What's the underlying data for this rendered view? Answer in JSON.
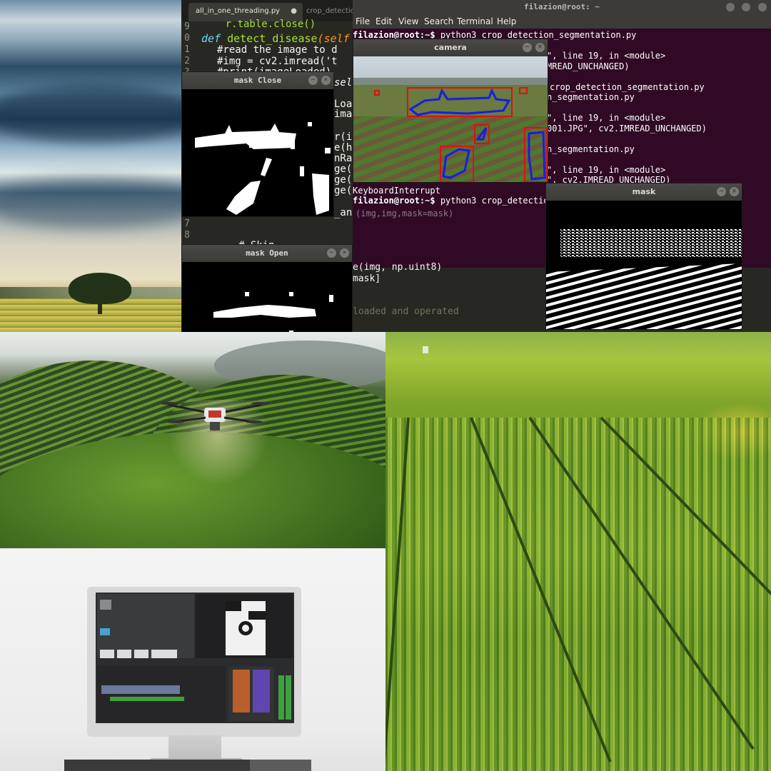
{
  "editor": {
    "tab_active": "all_in_one_threading.py",
    "tab_active_dot": "●",
    "tab_inactive": "crop_detectio",
    "lines": [
      {
        "n": "9",
        "text": "    r.table.close()"
      },
      {
        "n": "0",
        "kw": "def",
        "fn": "detect_disease",
        "rest": "(self"
      },
      {
        "n": "1",
        "cm": "#read the image to d"
      },
      {
        "n": "2",
        "text": "#img = cv2.imread('t"
      },
      {
        "n": "3",
        "cm": "#print(imageLoaded)"
      }
    ],
    "self_fragment": "sel",
    "partial_lines": [
      "Loa",
      "ima",
      "r(i",
      "e(h",
      "nRa",
      "ge(",
      "ge(",
      "ge("
    ],
    "lower_lines": [
      {
        "n": "7",
        "text": ""
      },
      {
        "n": "8",
        "text": ""
      }
    ],
    "lower_fragment": "_an",
    "comment_fragment": "# Skin"
  },
  "windows": {
    "mask_close_title": "mask Close",
    "mask_open_title": "mask Open",
    "camera_title": "camera",
    "mask_title": "mask",
    "btn_min": "−",
    "btn_close": "×"
  },
  "terminal": {
    "title": "filazion@root: ~",
    "menu": [
      "File",
      "Edit",
      "View",
      "Search",
      "Terminal",
      "Help"
    ],
    "lines": [
      {
        "prompt": "filazion@root:~$ ",
        "text": "python3 crop_detection_segmentation.py"
      },
      {
        "text": "\", line 19, in <module>"
      },
      {
        "text": "MREAD_UNCHANGED)"
      },
      {
        "text": "crop_detection_segmentation.py"
      },
      {
        "text": "n_segmentation.py"
      },
      {
        "text": "\", line 19, in <module>"
      },
      {
        "text": "001.JPG\", cv2.IMREAD_UNCHANGED)"
      },
      {
        "text": "n_segmentation.py"
      },
      {
        "text": "\", line 19, in <module>"
      },
      {
        "text": "\", cv2.IMREAD_UNCHANGED)"
      },
      {
        "text": "KeyboardInterrupt"
      },
      {
        "prompt": "filazion@root:~$ ",
        "text": "python3 crop_detectio"
      }
    ],
    "behind_lines": [
      "(img,img,mask=mask)",
      "e(img, np.uint8)",
      "mask]",
      "loaded and operated"
    ]
  },
  "colors": {
    "editor_bg": "#272822",
    "terminal_bg": "#300a24",
    "detection_box": "#e01010",
    "segment_outline": "#1520e0"
  },
  "photos": {
    "sky": "landscape-sky-tree-photo",
    "drone": "drone-spraying-tea-field-photo",
    "monitor": "desktop-monitor-video-editor-photo",
    "rice": "rice-field-aerial-photo"
  }
}
